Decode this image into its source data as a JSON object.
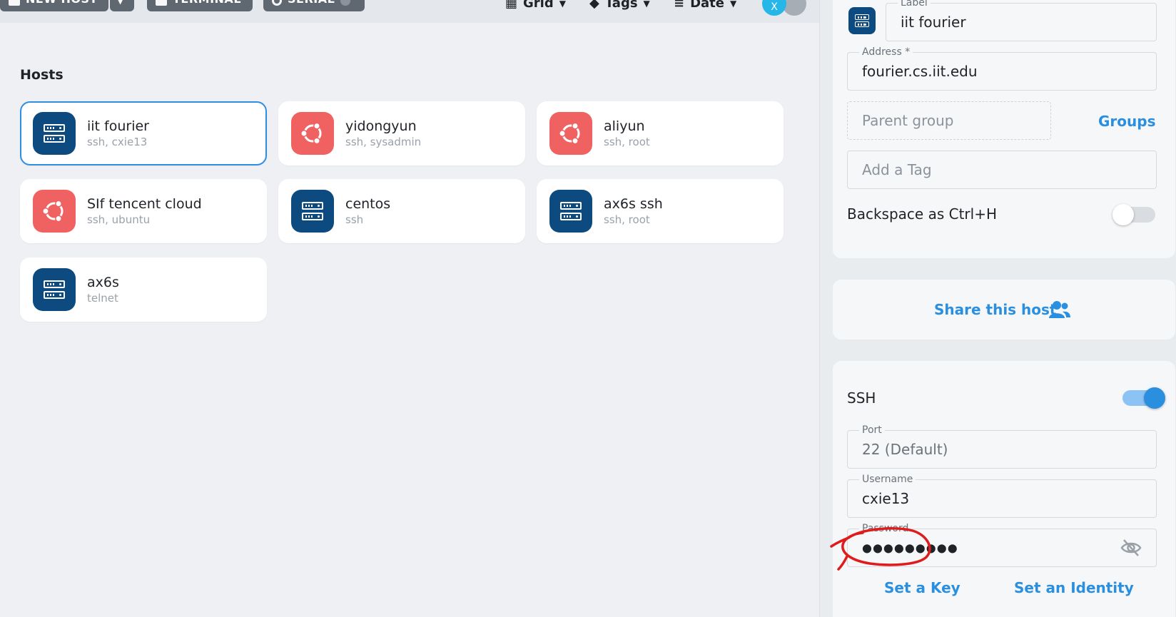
{
  "toolbar": {
    "new_host_label": "NEW HOST",
    "terminal_label": "TERMINAL",
    "serial_label": "SERIAL",
    "view_label": "Grid",
    "tags_label": "Tags",
    "sort_label": "Date",
    "avatar_letter": "X"
  },
  "hosts": {
    "section_title": "Hosts",
    "items": [
      {
        "name": "iit fourier",
        "sub": "ssh, cxie13",
        "icon": "server-icon"
      },
      {
        "name": "yidongyun",
        "sub": "ssh, sysadmin",
        "icon": "ubuntu-icon"
      },
      {
        "name": "aliyun",
        "sub": "ssh, root",
        "icon": "ubuntu-icon"
      },
      {
        "name": "SIf tencent cloud",
        "sub": "ssh, ubuntu",
        "icon": "ubuntu-icon"
      },
      {
        "name": "centos",
        "sub": "ssh",
        "icon": "server-icon"
      },
      {
        "name": "ax6s ssh",
        "sub": "ssh, root",
        "icon": "server-icon"
      },
      {
        "name": "ax6s",
        "sub": "telnet",
        "icon": "server-icon"
      }
    ]
  },
  "details": {
    "label_caption": "Label",
    "label_value": "iit fourier",
    "address_caption": "Address *",
    "address_value": "fourier.cs.iit.edu",
    "parent_group_placeholder": "Parent group",
    "groups_link": "Groups",
    "tag_placeholder": "Add a Tag",
    "backspace_label": "Backspace as Ctrl+H",
    "share_label": "Share this host",
    "ssh_label": "SSH",
    "port_caption": "Port",
    "port_value": "22 (Default)",
    "username_caption": "Username",
    "username_value": "cxie13",
    "password_caption": "Password",
    "password_value": "●●●●●●●●●",
    "set_key_link": "Set a Key",
    "set_identity_link": "Set an Identity"
  },
  "colors": {
    "accent": "#2b8fe0",
    "server_icon_bg": "#0d4a80",
    "ubuntu_icon_bg": "#f06161",
    "annotation": "#e01b1b"
  }
}
